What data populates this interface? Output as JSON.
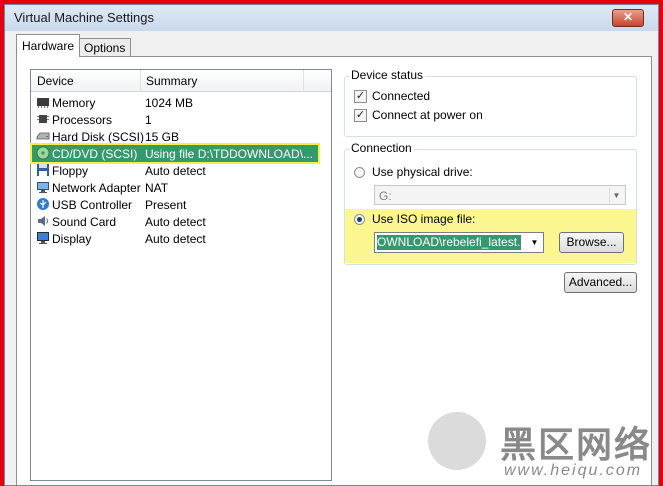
{
  "window": {
    "title": "Virtual Machine Settings",
    "close_glyph": "✕"
  },
  "tabs": [
    {
      "label": "Hardware",
      "active": true
    },
    {
      "label": "Options",
      "active": false
    }
  ],
  "device_list": {
    "columns": [
      "Device",
      "Summary"
    ],
    "rows": [
      {
        "name": "Memory",
        "summary": "1024 MB",
        "icon": "memory-icon"
      },
      {
        "name": "Processors",
        "summary": "1",
        "icon": "processor-icon"
      },
      {
        "name": "Hard Disk (SCSI)",
        "summary": "15 GB",
        "icon": "hard-disk-icon"
      },
      {
        "name": "CD/DVD (SCSI)",
        "summary": "Using file D:\\TDDOWNLOAD\\...",
        "icon": "cd-dvd-icon",
        "selected": true
      },
      {
        "name": "Floppy",
        "summary": "Auto detect",
        "icon": "floppy-icon"
      },
      {
        "name": "Network Adapter",
        "summary": "NAT",
        "icon": "network-adapter-icon"
      },
      {
        "name": "USB Controller",
        "summary": "Present",
        "icon": "usb-icon"
      },
      {
        "name": "Sound Card",
        "summary": "Auto detect",
        "icon": "sound-card-icon"
      },
      {
        "name": "Display",
        "summary": "Auto detect",
        "icon": "display-icon"
      }
    ]
  },
  "device_status": {
    "title": "Device status",
    "connected": {
      "label": "Connected",
      "checked": true
    },
    "connect_at_power_on": {
      "label": "Connect at power on",
      "checked": true
    }
  },
  "connection": {
    "title": "Connection",
    "physical": {
      "label": "Use physical drive:",
      "selected": false,
      "value": "G:"
    },
    "iso": {
      "label": "Use ISO image file:",
      "selected": true,
      "value": "OWNLOAD\\rebelefi_latest.iso"
    },
    "browse_label": "Browse...",
    "check_glyph": "✓",
    "arrow_glyph": "▼"
  },
  "advanced_label": "Advanced...",
  "watermark": {
    "cn": "黑区网络",
    "url": "www.heiqu.com"
  },
  "colors": {
    "selection": "#33996e",
    "highlight": "#fbf68f",
    "frame": "#e3020b"
  }
}
